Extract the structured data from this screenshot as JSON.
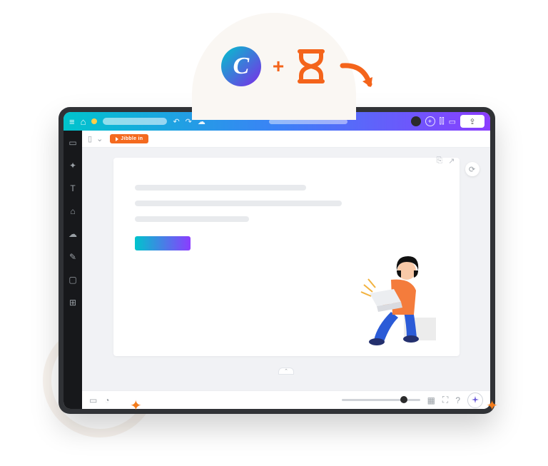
{
  "badge": {
    "canva_letter": "C",
    "plus": "+"
  },
  "topbar": {
    "title": " ",
    "share_label": "⇪"
  },
  "controlbar": {
    "jibble_label": "Jibble in"
  },
  "colors": {
    "accent": "#f46a1f",
    "gradient_start": "#00c4cc",
    "gradient_end": "#8b3dff"
  }
}
